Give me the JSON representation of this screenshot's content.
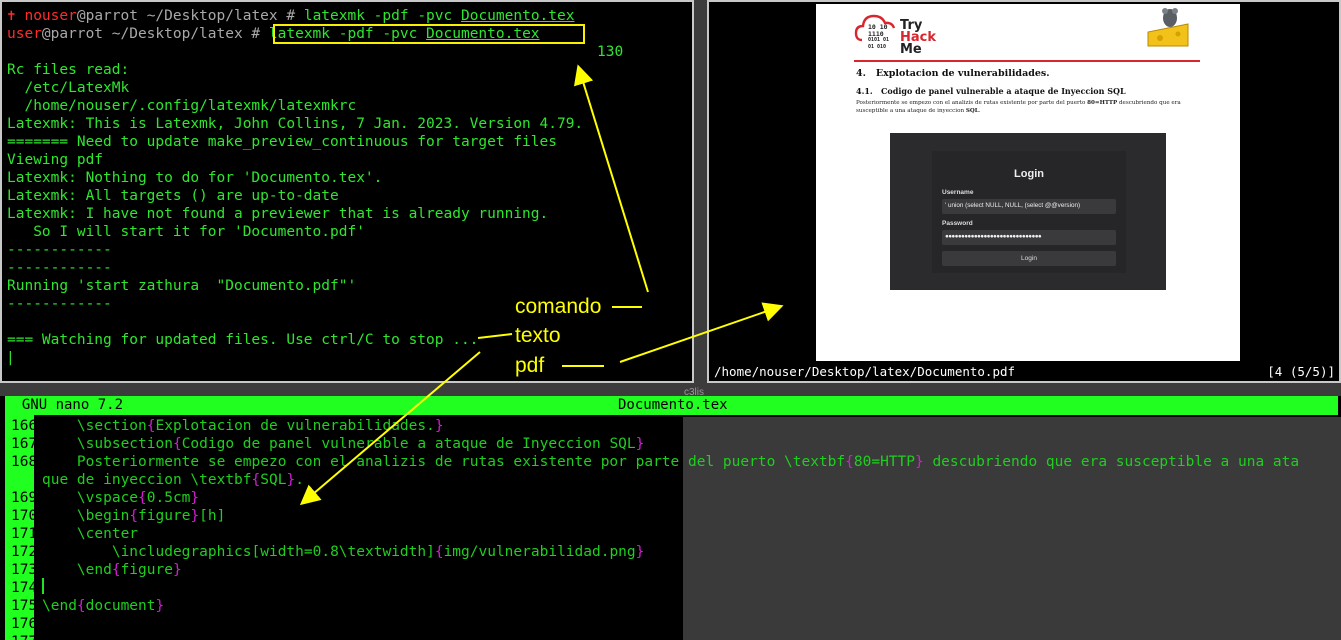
{
  "terminal": {
    "lines": [
      {
        "user": "nouser",
        "host": "@parrot",
        "path": " ~/Desktop/latex # ",
        "cmd": "latexmk -pdf -pvc ",
        "file": "Documento.tex",
        "tail": "                ✝ no"
      },
      {
        "user": "user",
        "host": "@parrot",
        "path": " ~/Desktop/latex # ",
        "cmd": "latexmk -pdf -pvc ",
        "file": "Documento.tex"
      }
    ],
    "number_label": "130",
    "output": [
      "Rc files read:",
      "  /etc/LatexMk",
      "  /home/nouser/.config/latexmk/latexmkrc",
      "Latexmk: This is Latexmk, John Collins, 7 Jan. 2023. Version 4.79.",
      "======= Need to update make_preview_continuous for target files",
      "Viewing pdf",
      "Latexmk: Nothing to do for 'Documento.tex'.",
      "Latexmk: All targets () are up-to-date",
      "Latexmk: I have not found a previewer that is already running.",
      "   So I will start it for 'Documento.pdf'",
      "------------",
      "------------",
      "Running 'start zathura  \"Documento.pdf\"'",
      "------------",
      "",
      "=== Watching for updated files. Use ctrl/C to stop ..."
    ],
    "cursor": "|"
  },
  "pdf_viewer": {
    "logo": {
      "text1": "Try",
      "text2": "Hack",
      "text3": "Me",
      "bits": [
        "10 10",
        "1110",
        "0101 01",
        "01 010"
      ]
    },
    "section": "4.   Explotacion de vulnerabilidades.",
    "subsection": "4.1.   Codigo de panel vulnerable a ataque de Inyeccion SQL",
    "para_1": "Posteriormente se empezo con el analizis de rutas existente por parte del puerto ",
    "para_bold": "80=HTTP",
    "para_2": " descubriendo que era susceptible a una ataque de inyeccion ",
    "para_bold2": "SQL",
    "para_end": ".",
    "login": {
      "title": "Login",
      "username_label": "Username",
      "username_value": "' union (select NULL, NULL, (select @@version)",
      "password_label": "Password",
      "password_value": "●●●●●●●●●●●●●●●●●●●●●●●●●●●●●●",
      "button": "Login"
    },
    "status_path": "/home/nouser/Desktop/latex/Documento.pdf",
    "status_page": "[4 (5/5)]"
  },
  "nano": {
    "title": "  GNU nano 7.2",
    "filename": "Documento.tex",
    "lines": [
      {
        "n": "166",
        "segs": [
          [
            "t",
            "    \\section"
          ],
          [
            "m",
            "{"
          ],
          [
            "t",
            "Explotacion de vulnerabilidades."
          ],
          [
            "m",
            "}"
          ]
        ]
      },
      {
        "n": "167",
        "segs": [
          [
            "t",
            "    \\subsection"
          ],
          [
            "m",
            "{"
          ],
          [
            "t",
            "Codigo de panel vulnerable a ataque de Inyeccion SQL"
          ],
          [
            "m",
            "}"
          ]
        ]
      },
      {
        "n": "168",
        "segs": [
          [
            "t",
            "    Posteriormente se empezo con el analizis de rutas existente por parte del puerto \\textbf"
          ],
          [
            "m",
            "{"
          ],
          [
            "t",
            "80=HTTP"
          ],
          [
            "m",
            "}"
          ],
          [
            "t",
            " descubriendo que era susceptible a una ata"
          ]
        ]
      },
      {
        "n": "",
        "segs": [
          [
            "t",
            "que de inyeccion \\textbf"
          ],
          [
            "m",
            "{"
          ],
          [
            "t",
            "SQL"
          ],
          [
            "m",
            "}"
          ],
          [
            "t",
            "."
          ]
        ]
      },
      {
        "n": "169",
        "segs": [
          [
            "t",
            "    \\vspace"
          ],
          [
            "m",
            "{"
          ],
          [
            "t",
            "0.5cm"
          ],
          [
            "m",
            "}"
          ]
        ]
      },
      {
        "n": "170",
        "segs": [
          [
            "t",
            "    \\begin"
          ],
          [
            "m",
            "{"
          ],
          [
            "t",
            "figure"
          ],
          [
            "m",
            "}"
          ],
          [
            "t",
            "[h]"
          ]
        ]
      },
      {
        "n": "171",
        "segs": [
          [
            "t",
            "    \\center"
          ]
        ]
      },
      {
        "n": "172",
        "segs": [
          [
            "t",
            "        \\includegraphics[width=0.8\\textwidth]"
          ],
          [
            "m",
            "{"
          ],
          [
            "t",
            "img/vulnerabilidad.png"
          ],
          [
            "m",
            "}"
          ]
        ]
      },
      {
        "n": "173",
        "segs": [
          [
            "t",
            "    \\end"
          ],
          [
            "m",
            "{"
          ],
          [
            "t",
            "figure"
          ],
          [
            "m",
            "}"
          ]
        ]
      },
      {
        "n": "174",
        "segs": [
          [
            "t",
            ""
          ]
        ]
      },
      {
        "n": "175",
        "segs": [
          [
            "t",
            "\\end"
          ],
          [
            "m",
            "{"
          ],
          [
            "t",
            "document"
          ],
          [
            "m",
            "}"
          ]
        ]
      },
      {
        "n": "176",
        "segs": [
          [
            "t",
            ""
          ]
        ]
      },
      {
        "n": "177",
        "segs": [
          [
            "t",
            ""
          ]
        ]
      }
    ]
  },
  "annotations": {
    "comando": "comando",
    "texto": "texto",
    "pdf": "pdf",
    "faint_label": "c3lis",
    "color": "#ffff00"
  }
}
